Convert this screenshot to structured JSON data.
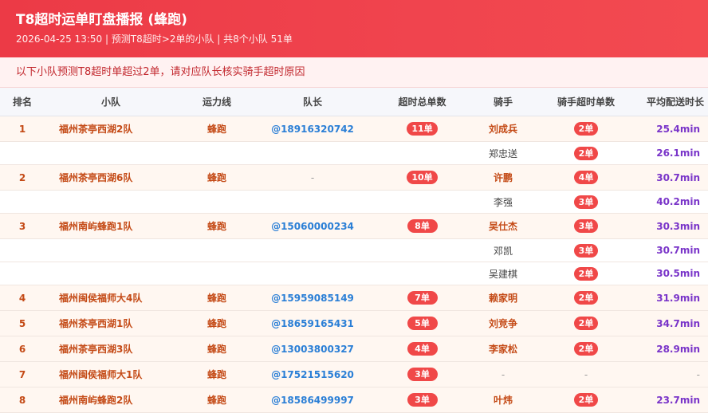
{
  "header": {
    "title": "T8超时运单盯盘播报 (蜂跑)",
    "subtitle": "2026-04-25 13:50 | 预测T8超时>2单的小队 | 共8个小队 51单"
  },
  "notice": "以下小队预测T8超时单超过2单，请对应队长核实骑手超时原因",
  "columns": [
    "排名",
    "小队",
    "运力线",
    "队长",
    "超时总单数",
    "骑手",
    "骑手超时单数",
    "平均配送时长"
  ],
  "rows": [
    {
      "kind": "main",
      "rank": "1",
      "team": "福州茶亭西湖2队",
      "line": "蜂跑",
      "leader": "@18916320742",
      "total": "11单",
      "rider": "刘成兵",
      "rider_count": "2单",
      "avg": "25.4min"
    },
    {
      "kind": "sub",
      "rider": "郑忠送",
      "rider_count": "2单",
      "avg": "26.1min"
    },
    {
      "kind": "main",
      "rank": "2",
      "team": "福州茶亭西湖6队",
      "line": "蜂跑",
      "leader": "-",
      "total": "10单",
      "rider": "许鹏",
      "rider_count": "4单",
      "avg": "30.7min"
    },
    {
      "kind": "sub",
      "rider": "李强",
      "rider_count": "3单",
      "avg": "40.2min"
    },
    {
      "kind": "main",
      "rank": "3",
      "team": "福州南屿蜂跑1队",
      "line": "蜂跑",
      "leader": "@15060000234",
      "total": "8单",
      "rider": "吴仕杰",
      "rider_count": "3单",
      "avg": "30.3min"
    },
    {
      "kind": "sub",
      "rider": "邓凯",
      "rider_count": "3单",
      "avg": "30.7min"
    },
    {
      "kind": "sub",
      "rider": "吴建棋",
      "rider_count": "2单",
      "avg": "30.5min"
    },
    {
      "kind": "main",
      "rank": "4",
      "team": "福州闽侯福师大4队",
      "line": "蜂跑",
      "leader": "@15959085149",
      "total": "7单",
      "rider": "赖家明",
      "rider_count": "2单",
      "avg": "31.9min"
    },
    {
      "kind": "main",
      "rank": "5",
      "team": "福州茶亭西湖1队",
      "line": "蜂跑",
      "leader": "@18659165431",
      "total": "5单",
      "rider": "刘竞争",
      "rider_count": "2单",
      "avg": "34.7min"
    },
    {
      "kind": "main",
      "rank": "6",
      "team": "福州茶亭西湖3队",
      "line": "蜂跑",
      "leader": "@13003800327",
      "total": "4单",
      "rider": "李家松",
      "rider_count": "2单",
      "avg": "28.9min"
    },
    {
      "kind": "main",
      "rank": "7",
      "team": "福州闽侯福师大1队",
      "line": "蜂跑",
      "leader": "@17521515620",
      "total": "3单",
      "rider": "-",
      "rider_count": "-",
      "avg": "-"
    },
    {
      "kind": "main",
      "rank": "8",
      "team": "福州南屿蜂跑2队",
      "line": "蜂跑",
      "leader": "@18586499997",
      "total": "3单",
      "rider": "叶炜",
      "rider_count": "2单",
      "avg": "23.7min"
    }
  ]
}
